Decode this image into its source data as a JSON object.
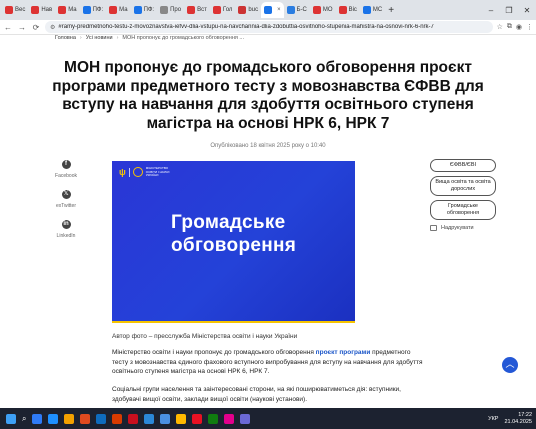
{
  "browser": {
    "tabs": [
      {
        "label": "Вес",
        "color": "#d33"
      },
      {
        "label": "Нав",
        "color": "#d33"
      },
      {
        "label": "Ма",
        "color": "#d33"
      },
      {
        "label": "ПФ:",
        "color": "#1a73e8"
      },
      {
        "label": "Ма",
        "color": "#d33"
      },
      {
        "label": "ПФ:",
        "color": "#1a73e8"
      },
      {
        "label": "Про",
        "color": "#888"
      },
      {
        "label": "Вст",
        "color": "#d33"
      },
      {
        "label": "Гол",
        "color": "#d33"
      },
      {
        "label": "buc",
        "color": "#c33"
      },
      {
        "label": "",
        "color": "#1a73e8",
        "active": true
      },
      {
        "label": "Б-С",
        "color": "#2a7de1"
      },
      {
        "label": "МО",
        "color": "#d33"
      },
      {
        "label": "Віс",
        "color": "#d33"
      },
      {
        "label": "МС",
        "color": "#1a73e8"
      }
    ],
    "new_tab": "+",
    "window_controls": [
      "–",
      "❐",
      "✕"
    ],
    "url": "#ramy-predmetnoho-testu-z-movoznavstva-iefvv-dlia-vstupu-na-navchannia-dlia-zdobuttia-osvitnoho-stupenia-mahistra-na-osnovi-nrk-6-nrk-7",
    "nav": {
      "back": "←",
      "forward": "→",
      "reload": "⟳"
    }
  },
  "page": {
    "breadcrumb": {
      "home": "Головна",
      "news": "Усі новини",
      "current": "МОН пропонує до громадського обговорення ..."
    },
    "title": "МОН пропонує до громадського обговорення проєкт програми предметного тесту з мовознавства ЄФВВ для вступу на навчання для здобуття освітнього ступеня магістра на основі НРК 6, НРК 7",
    "published": "Опубліковано 18 квітня 2025 року о 10:40",
    "share": [
      {
        "label": "Facebook",
        "glyph": "f",
        "icon": "facebook-icon"
      },
      {
        "label": "exTwitter",
        "glyph": "𝕏",
        "icon": "x-twitter-icon"
      },
      {
        "label": "LinkedIn",
        "glyph": "in",
        "icon": "linkedin-icon"
      }
    ],
    "hero": {
      "logo_text": "МІНІСТЕРСТВО ОСВІТИ І НАУКИ УКРАЇНИ",
      "headline_line1": "Громадське",
      "headline_line2": "обговорення"
    },
    "caption": "Автор фото – пресслужба Міністерства освіти і науки України",
    "paragraph1_before": "Міністерство освіти і науки пропонує до громадського обговорення ",
    "paragraph1_link": "проєкт програми",
    "paragraph1_after": " предметного тесту з мовознавства єдиного фахового вступного випробування для вступу на навчання для здобуття освітнього ступеня магістра на основі НРК 6, НРК 7.",
    "paragraph2": "Соціальні групи населення та заінтересовані сторони, на які поширюватиметься дія: вступники, здобувачі вищої освіти, заклади вищої освіти (наукові установи).",
    "tags": [
      "ЄФВВ/ЄВІ",
      "Вища освіта та освіта дорослих",
      "Громадське обговорення"
    ],
    "print_label": "Надрукувати",
    "to_top": "︿"
  },
  "taskbar": {
    "apps": [
      "#2f7bf6",
      "#1e90ff",
      "#f3a100",
      "#e04a1f",
      "#0f6cbd",
      "#d83b01",
      "#c80f1e",
      "#2b88d8",
      "#4a90e2",
      "#ffb900",
      "#e81123",
      "#107c10",
      "#e3008c",
      "#6b69d6"
    ],
    "lang": "УКР",
    "time": "17:22",
    "date": "21.04.2025"
  }
}
